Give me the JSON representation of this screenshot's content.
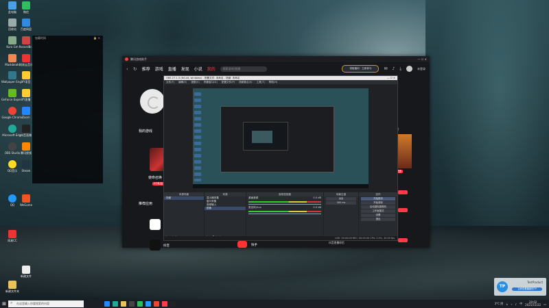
{
  "desktop": {
    "icons": [
      {
        "label": "此电脑",
        "color": "#4aa0e6"
      },
      {
        "label": "微信",
        "color": "#2dbe60"
      },
      {
        "label": "回收站",
        "color": "#9aa"
      },
      {
        "label": "百度网盘",
        "color": "#2e8be0"
      },
      {
        "label": "Kuro Gm",
        "color": "#8a8"
      },
      {
        "label": "RecordBr..",
        "color": "#c44"
      },
      {
        "label": "Maskbeats",
        "color": "#e85"
      },
      {
        "label": "网易云音乐",
        "color": "#e33"
      },
      {
        "label": "Wallpaper Engine",
        "color": "#378"
      },
      {
        "label": "YY语音",
        "color": "#fc3"
      },
      {
        "label": "GeForce Experience",
        "color": "#6b2"
      },
      {
        "label": "YY直播",
        "color": "#fc3"
      },
      {
        "label": "Google Chrome",
        "color": "#e43"
      },
      {
        "label": "Zoom",
        "color": "#28f"
      },
      {
        "label": "Microsoft Edge",
        "color": "#2a9"
      },
      {
        "label": "抖音直播",
        "color": "#222"
      },
      {
        "label": "OBS Studio",
        "color": "#444"
      },
      {
        "label": "腾讯视频",
        "color": "#f80"
      },
      {
        "label": "QQ音乐",
        "color": "#fd2"
      },
      {
        "label": "Steam",
        "color": "#234"
      },
      {
        "label": "QQ",
        "color": "#29f"
      },
      {
        "label": "WeGame",
        "color": "#e52"
      },
      {
        "label": "网易CC",
        "color": "#e33"
      },
      {
        "label": "新建文件",
        "color": "#eee"
      },
      {
        "label": "新建文件夹",
        "color": "#e8c35a"
      }
    ]
  },
  "ghost_panel": {
    "title": "加载时间"
  },
  "app": {
    "title": "腾讯游戏助手",
    "nav": {
      "back": "‹",
      "refresh": "↻",
      "items": [
        "推荐",
        "游戏",
        "直播",
        "发现",
        "小说",
        "我的"
      ],
      "active_index": 5,
      "search_placeholder": "搜索游戏/直播",
      "promo": "领取福利 · 立即参与",
      "user": "未登录"
    },
    "my_games_title": "我的游戏",
    "game_title": "使命召唤",
    "game_tag": "3个礼包",
    "recommend_title": "推荐应用",
    "recs": [
      {
        "name": "QQ"
      },
      {
        "name": "抖音"
      },
      {
        "name": "快手"
      }
    ],
    "right_label": "对",
    "right_tag": "更多",
    "right_text": "去领取"
  },
  "obs": {
    "title": "OBS 27.1.3 (64-bit, windows) - 配置文件: 未命名 - 场景: 未命名",
    "menu": [
      "文件(F)",
      "编辑(E)",
      "视图(V)",
      "停靠窗口(D)",
      "配置文件(P)",
      "场景集合(S)",
      "工具(T)",
      "帮助(H)"
    ],
    "panels": {
      "scenes": "来源场景",
      "sources": "来源",
      "mixer": "音频混音器",
      "transitions": "场景过渡",
      "controls": "控件"
    },
    "scene_items": [
      "场景"
    ],
    "source_items": [
      "显示器采集",
      "窗口采集",
      "音频输入",
      "图像"
    ],
    "mixer_items": [
      {
        "name": "桌面音频",
        "db": "0.0 dB"
      },
      {
        "name": "麦克风/Aux",
        "db": "0.0 dB"
      }
    ],
    "transition": "淡出",
    "transition_duration": "300 ms",
    "controls": [
      "开始推流",
      "开始录制",
      "启动虚拟摄像机",
      "工作室模式",
      "设置",
      "退出"
    ],
    "status": "LIVE: 00:00:00   REC: 00:00:00   CPU: 0.5%, 30.00 fps"
  },
  "tooltip": "抖音直播伴侣",
  "toast": {
    "title": "TestProduct",
    "bar": "立即查看最新的TP",
    "logo": "TP"
  },
  "taskbar": {
    "search_placeholder": "在这里输入你要搜索的内容",
    "temp": "3°C 阴",
    "time": "20:02",
    "date": "2021/11/22",
    "ime": "中"
  },
  "colors": {
    "accent": "#ff3b4a",
    "obs_bg": "#1f2125"
  }
}
